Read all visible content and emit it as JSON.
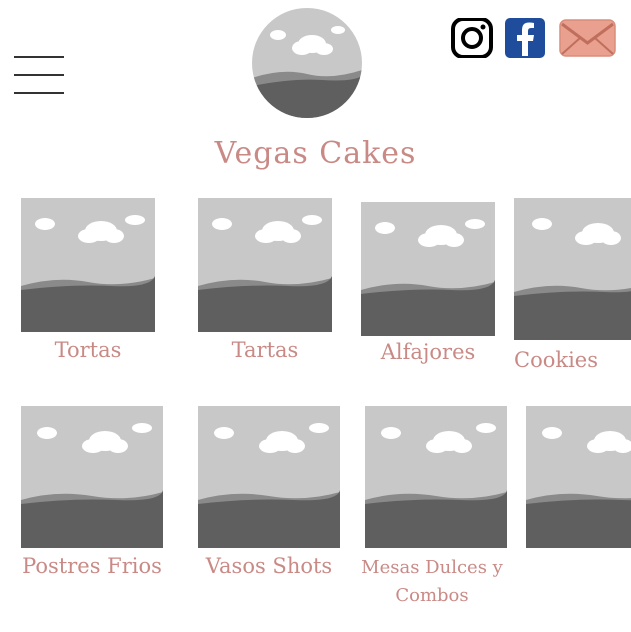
{
  "header": {
    "menu_icon": "hamburger-menu-icon",
    "logo_icon": "image-placeholder-icon",
    "site_title": "Vegas Cakes",
    "social": [
      {
        "name": "instagram-icon"
      },
      {
        "name": "facebook-icon",
        "color": "#1f4d9c"
      },
      {
        "name": "mail-icon",
        "color": "#e9a08f"
      }
    ]
  },
  "colors": {
    "accent": "#c98a86",
    "placeholder_sky": "#c8c8c8",
    "placeholder_hill_light": "#8a8a8a",
    "placeholder_hill_dark": "#5f5f5f"
  },
  "categories": {
    "row1": [
      {
        "label": "Tortas"
      },
      {
        "label": "Tartas"
      },
      {
        "label": "Alfajores"
      },
      {
        "label": "Cookies"
      }
    ],
    "row2": [
      {
        "label": "Postres Frios"
      },
      {
        "label": "Vasos Shots"
      },
      {
        "label": "Mesas Dulces y Combos"
      },
      {
        "label": ""
      }
    ]
  }
}
